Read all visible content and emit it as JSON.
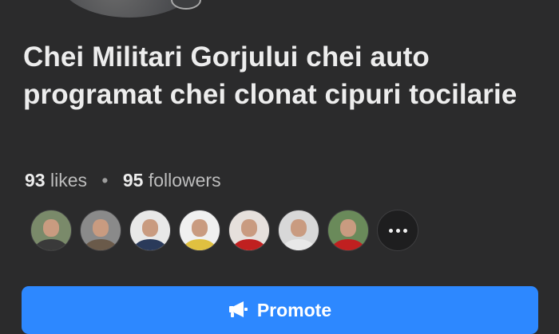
{
  "page": {
    "title": "Chei Militari Gorjului  chei auto programat chei clonat cipuri tocilarie",
    "likes_count": "93",
    "likes_label": "likes",
    "separator": "•",
    "followers_count": "95",
    "followers_label": "followers"
  },
  "avatars": [
    {
      "name": "follower-avatar-1",
      "bg": "#7a8a6a",
      "body": "#3a3a3a"
    },
    {
      "name": "follower-avatar-2",
      "bg": "#8a8a8a",
      "body": "#6a5a4a"
    },
    {
      "name": "follower-avatar-3",
      "bg": "#e8e8e8",
      "body": "#2a3a5a"
    },
    {
      "name": "follower-avatar-4",
      "bg": "#f0f0f0",
      "body": "#e0c040"
    },
    {
      "name": "follower-avatar-5",
      "bg": "#e6e0dc",
      "body": "#c02020"
    },
    {
      "name": "follower-avatar-6",
      "bg": "#d8d8d8",
      "body": "#e8e8e8"
    },
    {
      "name": "follower-avatar-7",
      "bg": "#6a8a5a",
      "body": "#c02020"
    }
  ],
  "more_avatars_icon": "more-dots-icon",
  "promote": {
    "label": "Promote",
    "icon": "megaphone-icon",
    "color": "#2d88ff"
  },
  "colors": {
    "background": "#2b2b2c",
    "text": "#ededed",
    "secondary_text": "#bdbdbd"
  }
}
